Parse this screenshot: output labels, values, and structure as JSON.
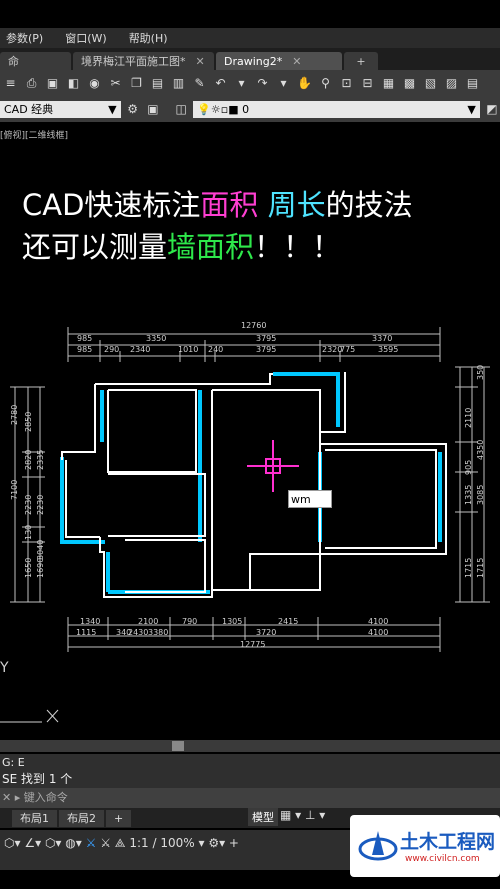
{
  "menu": {
    "items": [
      "参数(P)",
      "窗口(W)",
      "帮助(H)"
    ]
  },
  "tabs": [
    {
      "label": "命"
    },
    {
      "label": "境界梅江平面施工图*"
    },
    {
      "label": "Drawing2*"
    }
  ],
  "toolbar": {
    "workspace": "CAD 经典",
    "layer": "0",
    "view_label": "[俯视][二维线框]"
  },
  "overlay_title": {
    "line1_part1": "CAD快速标注",
    "line1_part2": "面积",
    "line1_part3": "周长",
    "line1_part4": "的技法",
    "line2_part1": "还可以测量",
    "line2_part2": "墙面积",
    "line2_part3": "！！！"
  },
  "dimensions": {
    "top_total": "12760",
    "top_row1": [
      "985",
      "3350",
      "3795",
      "3370"
    ],
    "top_row2": [
      "985",
      "290",
      "2340",
      "1010",
      "240",
      "3795",
      "2320",
      "775",
      "3595"
    ],
    "left": [
      "2780",
      "2850",
      "2820",
      "2335",
      "2230",
      "2230",
      "130",
      "3040",
      "1650",
      "1690"
    ],
    "left_total": "7100",
    "right": [
      "350",
      "2110",
      "4350",
      "905",
      "1335",
      "3085",
      "1715",
      "1715"
    ],
    "bottom_row1": [
      "1340",
      "2100",
      "790",
      "1305",
      "2415",
      "4100"
    ],
    "bottom_row2": [
      "1115",
      "340",
      "2430",
      "3380",
      "3720",
      "4100"
    ],
    "bottom_total": "12775"
  },
  "cursor_input": "wm",
  "command": {
    "line1": "G: E",
    "line2": "SE 找到 1 个",
    "prompt_placeholder": "键入命令"
  },
  "layouts": [
    "布局1",
    "布局2"
  ],
  "status": {
    "model": "模型",
    "scale": "1:1 / 100%"
  },
  "watermark": {
    "name": "土木工程网",
    "url": "www.civilcn.com"
  },
  "colors": {
    "wall": "#ffffff",
    "highlight": "#00c8ff",
    "crosshair": "#ff2fd0",
    "dim": "#cfcfcf"
  }
}
